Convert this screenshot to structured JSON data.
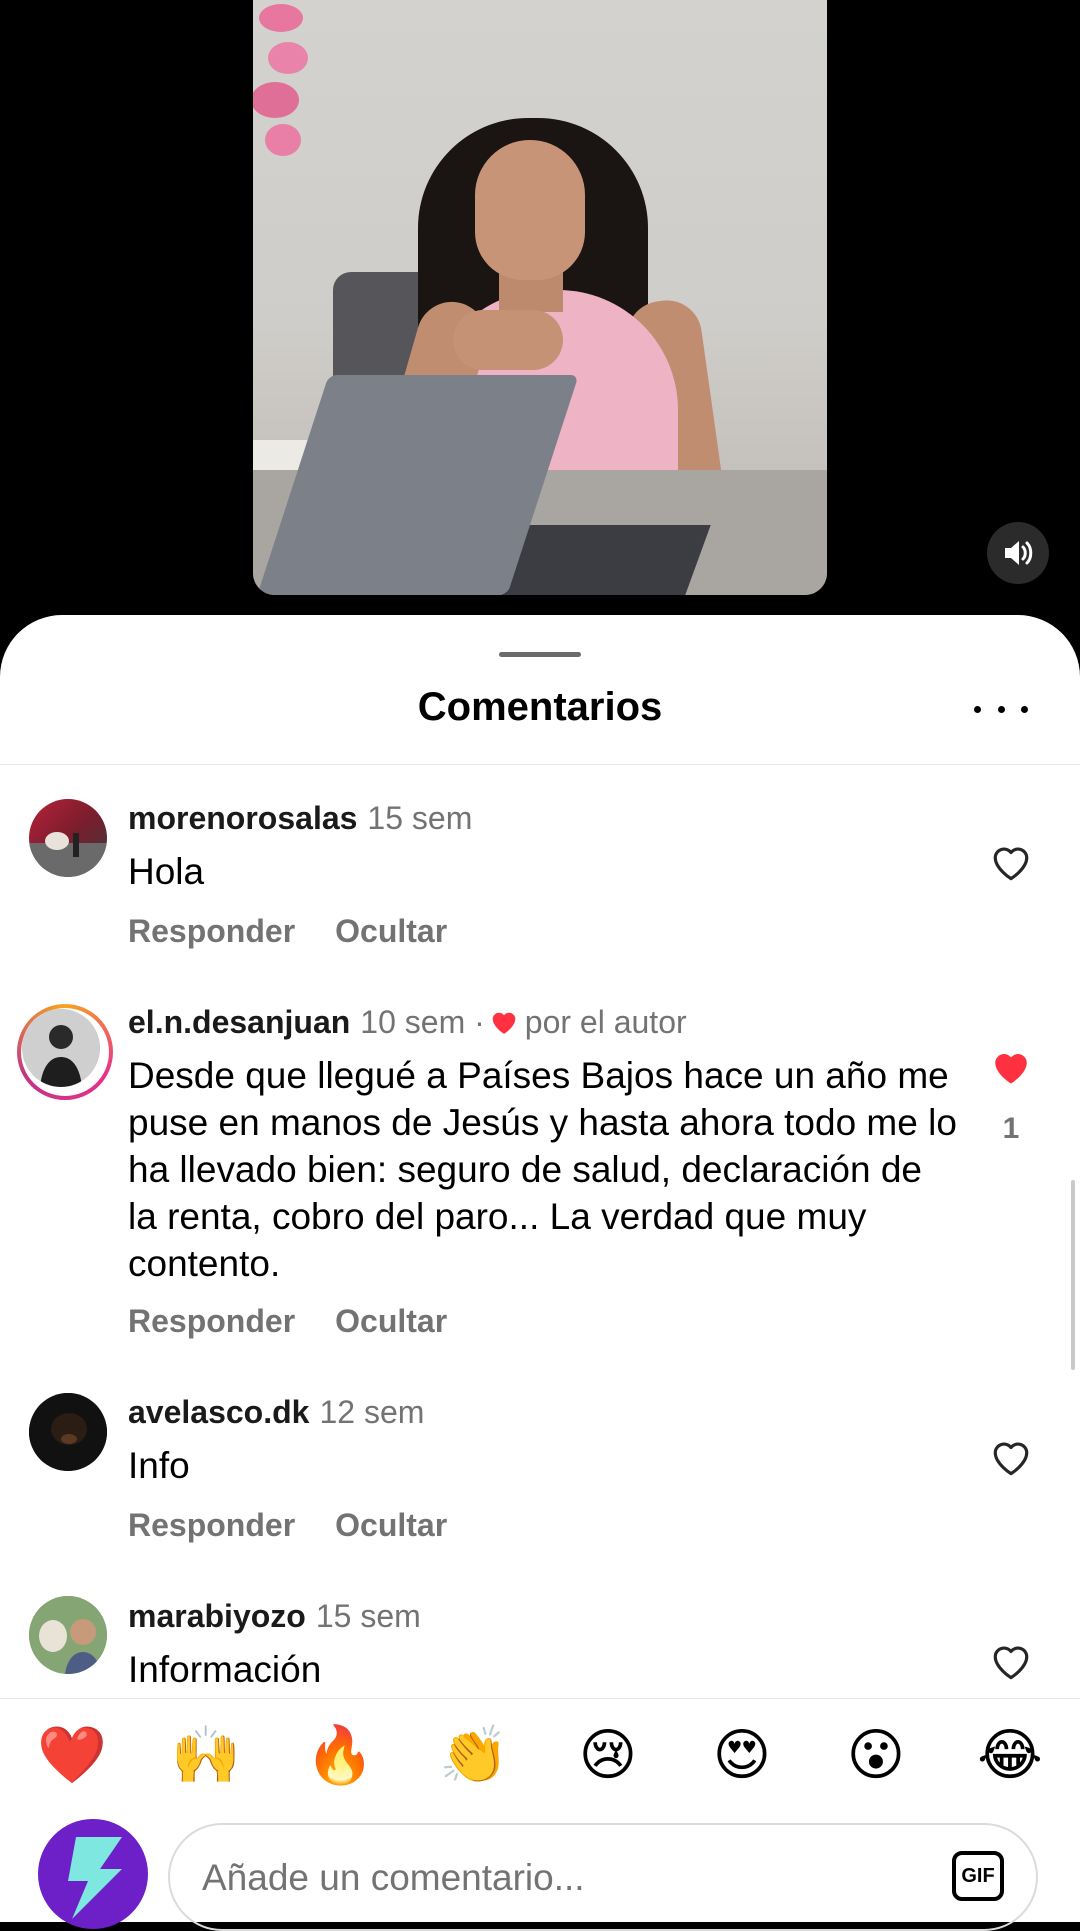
{
  "sheet": {
    "title": "Comentarios"
  },
  "comments": [
    {
      "username": "morenorosalas",
      "time": "15 sem",
      "text": "Hola",
      "reply_label": "Responder",
      "hide_label": "Ocultar",
      "liked": false
    },
    {
      "username": "el.n.desanjuan",
      "time": "10 sem",
      "author_liked_label": "por el autor",
      "text": "Desde que llegué a Países Bajos hace un año me puse en manos de Jesús y hasta ahora todo me lo ha llevado bien: seguro de salud, declaración de la renta, cobro del paro... La verdad que muy contento.",
      "reply_label": "Responder",
      "hide_label": "Ocultar",
      "liked": true,
      "like_count": "1"
    },
    {
      "username": "avelasco.dk",
      "time": "12 sem",
      "text": "Info",
      "reply_label": "Responder",
      "hide_label": "Ocultar",
      "liked": false
    },
    {
      "username": "marabiyozo",
      "time": "15 sem",
      "text": "Información",
      "liked": false
    }
  ],
  "emoji_reactions": [
    "❤️",
    "🙌",
    "🔥",
    "👏",
    "😢",
    "😍",
    "😮",
    "😂"
  ],
  "composer": {
    "placeholder": "Añade un comentario...",
    "gif_label": "GIF"
  },
  "colors": {
    "like_red": "#ff3040",
    "muted_text": "#737373",
    "avatar_purple": "#6d1fc8",
    "avatar_bolt": "#7ee8e0"
  }
}
